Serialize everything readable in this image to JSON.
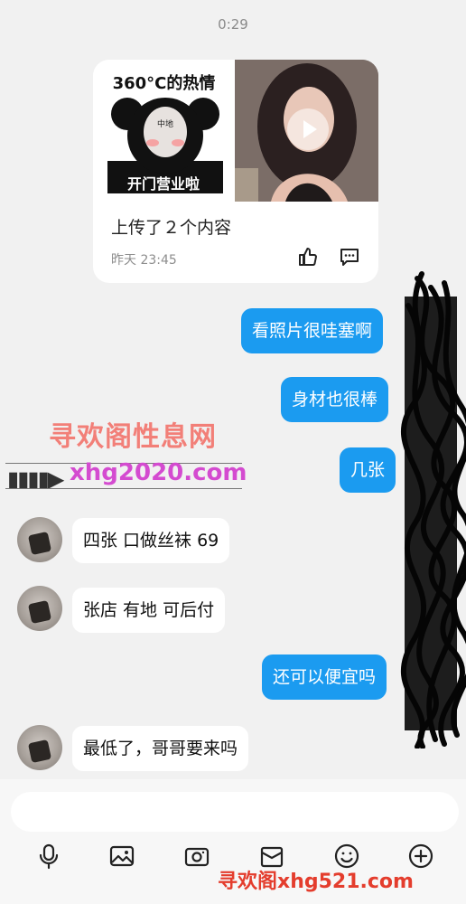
{
  "chat": {
    "timestamp": "0:29"
  },
  "post_card": {
    "meme_title": "360°C的热情",
    "meme_caption": "开门营业啦",
    "meme_face_text": "中地",
    "text": "上传了２个内容",
    "time": "昨天 23:45"
  },
  "messages": [
    {
      "side": "out",
      "text": "看照片很哇塞啊"
    },
    {
      "side": "out",
      "text": "身材也很棒"
    },
    {
      "side": "out",
      "text": "几张"
    },
    {
      "side": "in",
      "text": "四张 口做丝袜 69"
    },
    {
      "side": "in",
      "text": "张店 有地 可后付"
    },
    {
      "side": "out",
      "text": "还可以便宜吗"
    },
    {
      "side": "in",
      "text": "最低了，哥哥要来吗"
    }
  ],
  "watermark": {
    "title": "寻欢阁性息网",
    "arrow": "▮▮▮▮▶",
    "url": "xhg2020.com",
    "footer": "寻欢阁xhg521.com"
  },
  "composer": {
    "placeholder": "",
    "tools": [
      "microphone-icon",
      "image-icon",
      "camera-icon",
      "gift-icon",
      "emoji-icon",
      "plus-icon"
    ]
  },
  "colors": {
    "outgoing_bubble": "#1b9bf0",
    "incoming_bubble": "#ffffff",
    "background": "#f1f1f1"
  }
}
